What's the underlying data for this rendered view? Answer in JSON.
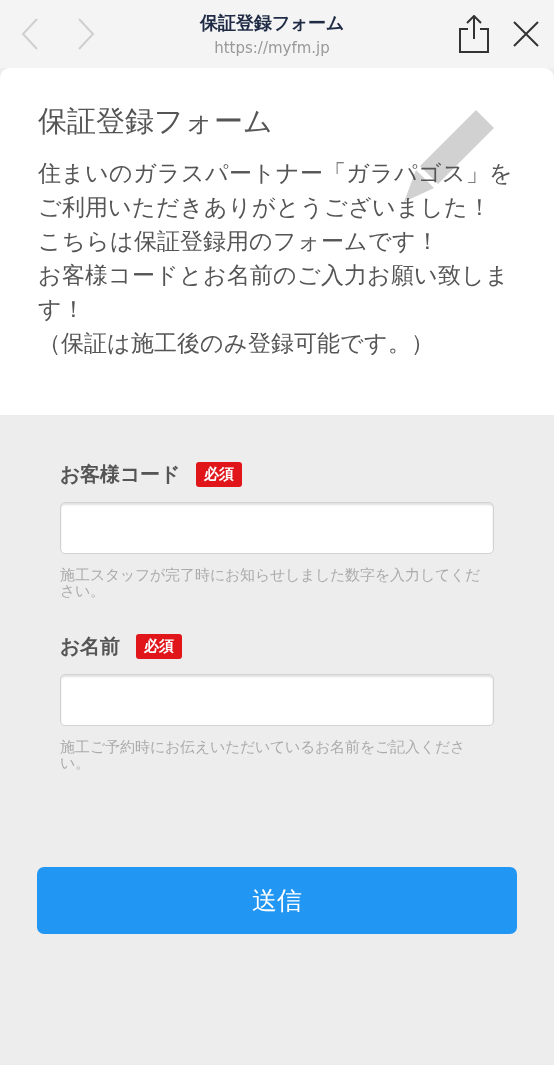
{
  "browser_bar": {
    "title": "保証登録フォーム",
    "url": "https://myfm.jp",
    "back": {
      "disabled": true
    },
    "forward": {
      "disabled": true
    }
  },
  "header": {
    "title": "保証登録フォーム",
    "description": [
      "住まいのガラスパートナー「ガラパゴス」を",
      "ご利用いただきありがとうございました！",
      "こちらは保証登録用のフォームです！",
      "お客様コードとお名前のご入力お願い致します！",
      "（保証は施工後のみ登録可能です。）"
    ]
  },
  "fields": [
    {
      "label": "お客様コード",
      "required_badge": "必須",
      "help": "施工スタッフが完了時にお知らせしました数字を入力してください。"
    },
    {
      "label": "お名前",
      "required_badge": "必須",
      "help": "施工ご予約時にお伝えいただいているお名前をご記入ください。"
    }
  ],
  "submit_button": "送信"
}
